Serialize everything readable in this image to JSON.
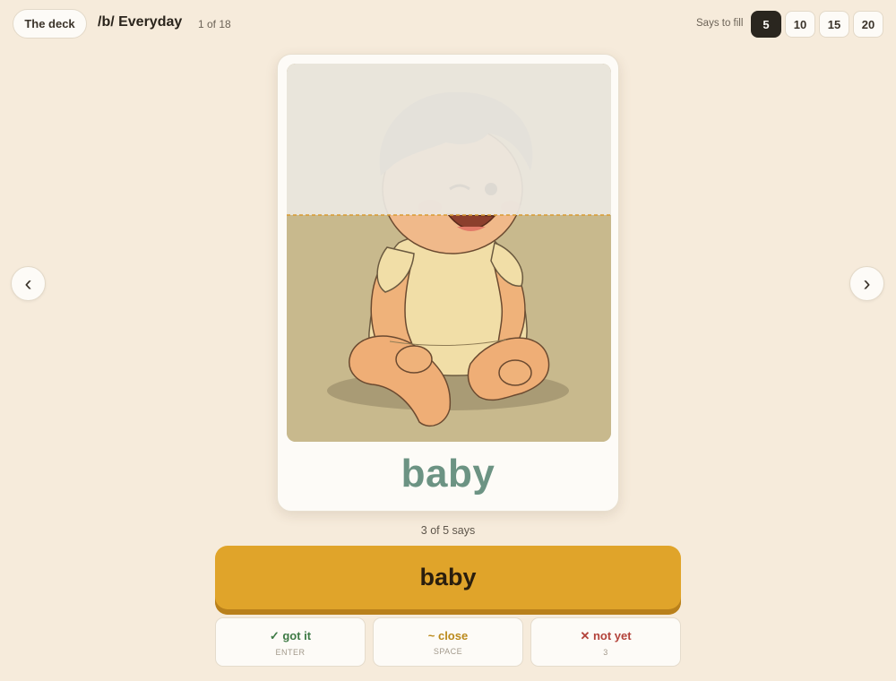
{
  "header": {
    "deck_button": "The deck",
    "title": "/b/ Everyday",
    "count": "1 of 18",
    "fill_label": "Says to fill",
    "fill_options": [
      "5",
      "10",
      "15",
      "20"
    ],
    "fill_selected": "5"
  },
  "nav": {
    "prev_icon": "‹",
    "next_icon": "›"
  },
  "card": {
    "image": "baby-illustration",
    "word": "baby",
    "fill_fraction": 0.6
  },
  "progress": {
    "text": "3 of 5 says",
    "done": 3,
    "total": 5
  },
  "say_button": {
    "label": "baby"
  },
  "grades": [
    {
      "label": "✓ got it",
      "key": "ENTER"
    },
    {
      "label": "~ close",
      "key": "SPACE"
    },
    {
      "label": "✕ not yet",
      "key": "3"
    }
  ],
  "colors": {
    "background": "#f6ebdb",
    "accent": "#e0a42a",
    "word": "#6c9383",
    "got": "#3e7a45",
    "close": "#bb8a1c",
    "not_yet": "#b3423a"
  }
}
